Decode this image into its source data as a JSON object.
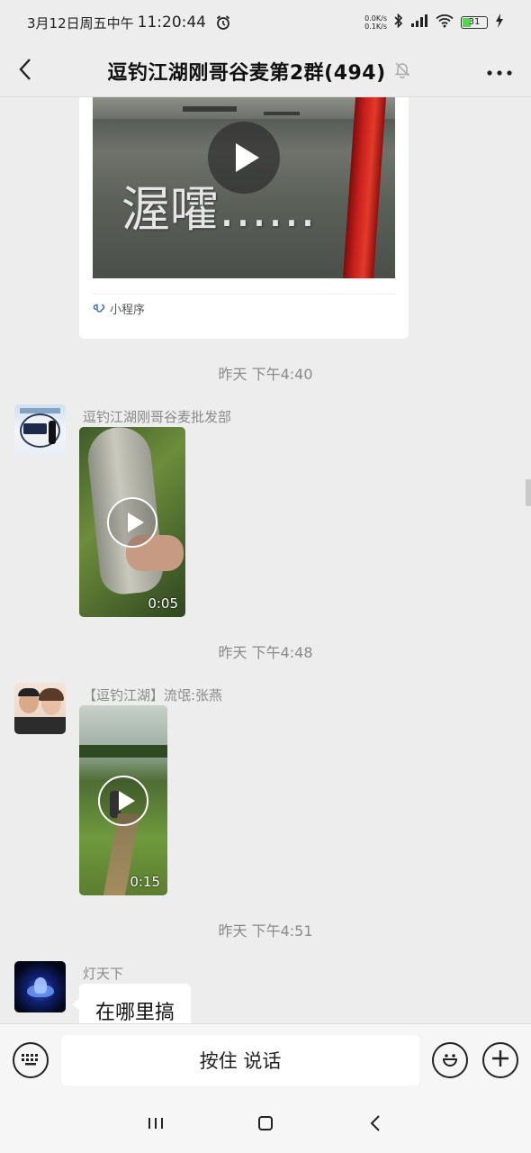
{
  "status_bar": {
    "date": "3月12日周五中午",
    "time": "11:20:44",
    "net_up": "0.0K/s",
    "net_down": "0.1K/s",
    "battery": "31"
  },
  "header": {
    "title": "逗钓江湖刚哥谷麦第2群(494)",
    "back_icon": "back-arrow-icon",
    "mute_icon": "muted-bell-icon",
    "more_icon": "more-dots-icon"
  },
  "messages": {
    "mini_program": {
      "overlay_text": "渥嚯……",
      "label": "小程序"
    },
    "ts1": "昨天 下午4:40",
    "msg1": {
      "sender": "逗钓江湖刚哥谷麦批发部",
      "duration": "0:05"
    },
    "ts2": "昨天 下午4:48",
    "msg2": {
      "sender": "【逗钓江湖】流氓:张燕",
      "duration": "0:15"
    },
    "ts3": "昨天 下午4:51",
    "msg3": {
      "sender": "灯天下",
      "text": "在哪里搞"
    }
  },
  "input_bar": {
    "voice_label": "按住 说话"
  },
  "colors": {
    "background": "#ededed",
    "accent_green": "#5bd15b"
  }
}
